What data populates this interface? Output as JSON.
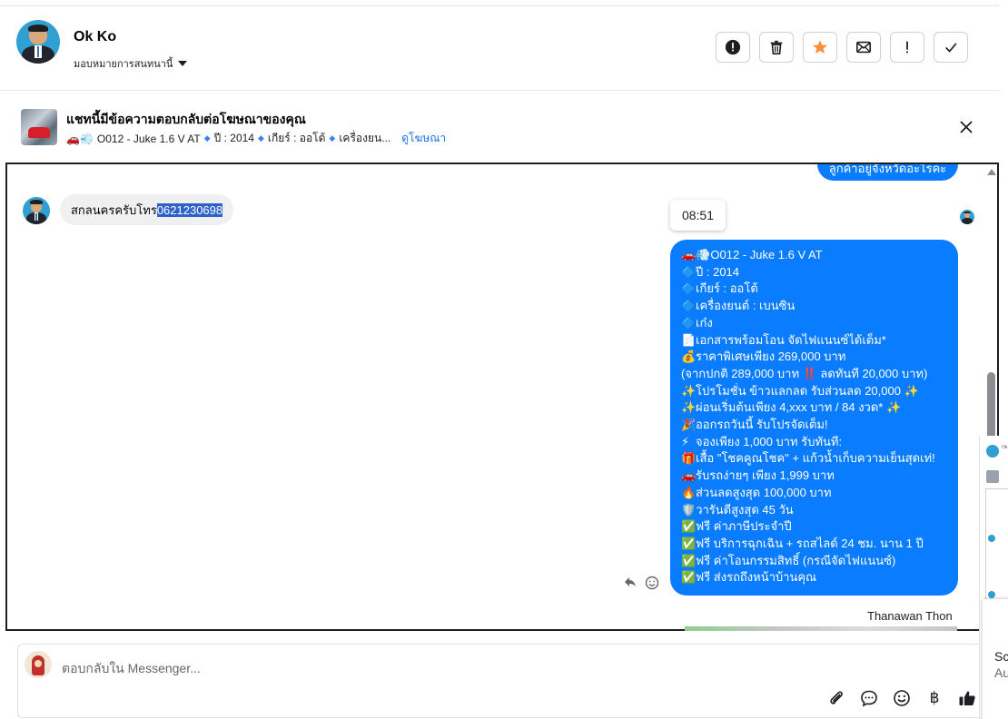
{
  "header": {
    "name": "Ok Ko",
    "assign_label": "มอบหมายการสนทนานี้",
    "toolbar": [
      {
        "name": "report-button",
        "icon": "alert-circle-icon"
      },
      {
        "name": "delete-button",
        "icon": "trash-icon"
      },
      {
        "name": "star-button",
        "icon": "star-icon"
      },
      {
        "name": "mark-unread-button",
        "icon": "envelope-icon"
      },
      {
        "name": "important-button",
        "icon": "exclamation-icon"
      },
      {
        "name": "done-button",
        "icon": "check-icon"
      }
    ]
  },
  "ad": {
    "title": "แชทนี้มีข้อความตอบกลับต่อโฆษณาของคุณ",
    "model": "O012 - Juke 1.6 V AT",
    "year": "ปี : 2014",
    "gear": "เกียร์ : ออโต้",
    "engine": "เครื่องยน...",
    "view_ad_link": "ดูโฆษณา"
  },
  "conversation": {
    "top_bubble_fragment": "ลูกค้าอยู่จังหวัดอะไรคะ",
    "incoming": {
      "text_before": "สกลนครครับโทร",
      "text_selected": "0621230698"
    },
    "timestamp": "08:51",
    "outgoing_lines": [
      {
        "emoji": "🚗💨",
        "text": "O012 - Juke 1.6 V AT"
      },
      {
        "emoji": "🔷",
        "text": "ปี : 2014"
      },
      {
        "emoji": "🔷",
        "text": "เกียร์ : ออโต้"
      },
      {
        "emoji": "🔷",
        "text": "เครื่องยนต์ : เบนซิน"
      },
      {
        "emoji": "🔷",
        "text": "เก๋ง"
      },
      {
        "emoji": "📄",
        "text": "เอกสารพร้อมโอน จัดไฟแนนซ์ได้เต็ม*"
      },
      {
        "emoji": "💰",
        "text": "ราคาพิเศษเพียง 269,000 บาท"
      },
      {
        "emoji": "",
        "text": "(จากปกติ 289,000 บาท ‼️ ลดทันที 20,000 บาท)"
      },
      {
        "emoji": "✨",
        "text": "โปรโมชั่น ข้าวแลกลด รับส่วนลด 20,000 ✨"
      },
      {
        "emoji": "✨",
        "text": "ผ่อนเริ่มต้นเพียง 4,xxx บาท / 84 งวด* ✨"
      },
      {
        "emoji": "🎉",
        "text": "ออกรถวันนี้ รับโปรจัดเต็ม!"
      },
      {
        "emoji": "⚡",
        "text": "จองเพียง 1,000 บาท รับทันที:"
      },
      {
        "emoji": "🎁",
        "text": "เสื้อ \"โชคคูณโชค\" + แก้วน้ำเก็บความเย็นสุดเท่!"
      },
      {
        "emoji": "🚗",
        "text": "รับรถง่ายๆ เพียง 1,999 บาท"
      },
      {
        "emoji": "🔥",
        "text": "ส่วนลดสูงสุด 100,000 บาท"
      },
      {
        "emoji": "🛡️",
        "text": "วารันตีสูงสุด 45 วัน"
      },
      {
        "emoji": "✅",
        "text": "ฟรี ค่าภาษีประจำปี"
      },
      {
        "emoji": "✅",
        "text": "ฟรี บริการฉุกเฉิน + รถสไลด์ 24 ชม. นาน 1 ปี"
      },
      {
        "emoji": "✅",
        "text": "ฟรี ค่าโอนกรรมสิทธิ์ (กรณีจัดไฟแนนซ์)"
      },
      {
        "emoji": "✅",
        "text": "ฟรี ส่งรถถึงหน้าบ้านคุณ"
      }
    ],
    "sender_name": "Thanawan Thon"
  },
  "composer": {
    "placeholder": "ตอบกลับใน Messenger..."
  },
  "right_panel": {
    "text_sc": "Sc",
    "text_au": "Au"
  }
}
